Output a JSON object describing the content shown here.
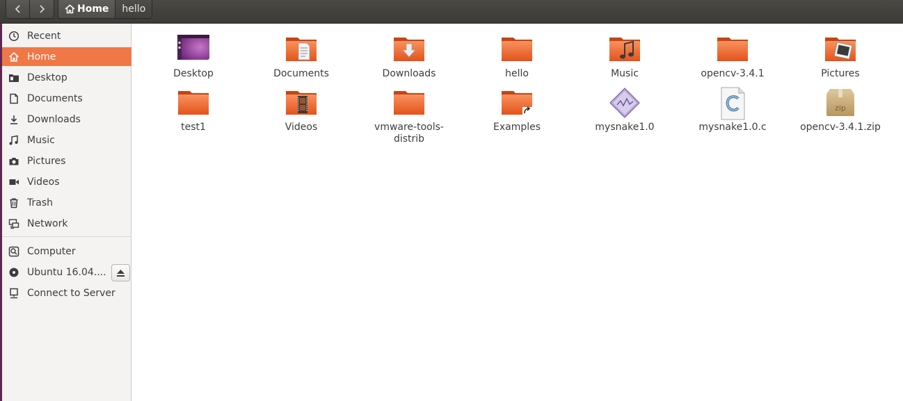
{
  "header": {
    "back_icon": "chevron-left-icon",
    "forward_icon": "chevron-right-icon",
    "breadcrumbs": [
      {
        "label": "Home",
        "icon": "home-icon",
        "active": true
      },
      {
        "label": "hello",
        "active": false
      }
    ]
  },
  "sidebar": {
    "items": [
      {
        "label": "Recent",
        "icon": "clock-icon"
      },
      {
        "label": "Home",
        "icon": "home-icon",
        "selected": true
      },
      {
        "label": "Desktop",
        "icon": "desktop-folder-icon"
      },
      {
        "label": "Documents",
        "icon": "document-icon"
      },
      {
        "label": "Downloads",
        "icon": "download-icon"
      },
      {
        "label": "Music",
        "icon": "music-note-icon"
      },
      {
        "label": "Pictures",
        "icon": "camera-icon"
      },
      {
        "label": "Videos",
        "icon": "video-icon"
      },
      {
        "label": "Trash",
        "icon": "trash-icon"
      },
      {
        "label": "Network",
        "icon": "network-icon"
      }
    ],
    "devices": [
      {
        "label": "Computer",
        "icon": "computer-icon"
      },
      {
        "label": "Ubuntu 16.04....",
        "icon": "disc-icon",
        "eject_icon": "eject-icon"
      },
      {
        "label": "Connect to Server",
        "icon": "server-icon"
      }
    ]
  },
  "files": [
    {
      "name": "Desktop",
      "icon": "desktop-folder-icon"
    },
    {
      "name": "Documents",
      "icon": "documents-folder-icon"
    },
    {
      "name": "Downloads",
      "icon": "downloads-folder-icon"
    },
    {
      "name": "hello",
      "icon": "folder-icon"
    },
    {
      "name": "Music",
      "icon": "music-folder-icon"
    },
    {
      "name": "opencv-3.4.1",
      "icon": "folder-icon"
    },
    {
      "name": "Pictures",
      "icon": "pictures-folder-icon"
    },
    {
      "name": "test1",
      "icon": "folder-icon"
    },
    {
      "name": "Videos",
      "icon": "videos-folder-icon"
    },
    {
      "name": "vmware-tools-distrib",
      "icon": "folder-icon"
    },
    {
      "name": "Examples",
      "icon": "link-folder-icon"
    },
    {
      "name": "mysnake1.0",
      "icon": "executable-icon"
    },
    {
      "name": "mysnake1.0.c",
      "icon": "c-source-file-icon"
    },
    {
      "name": "opencv-3.4.1.zip",
      "icon": "zip-archive-icon",
      "badge": "zip"
    }
  ],
  "colors": {
    "accent": "#f07746",
    "folder": "#e95420",
    "titlebar": "#3c3b37",
    "sidebar_bg": "#f4f3f1"
  }
}
